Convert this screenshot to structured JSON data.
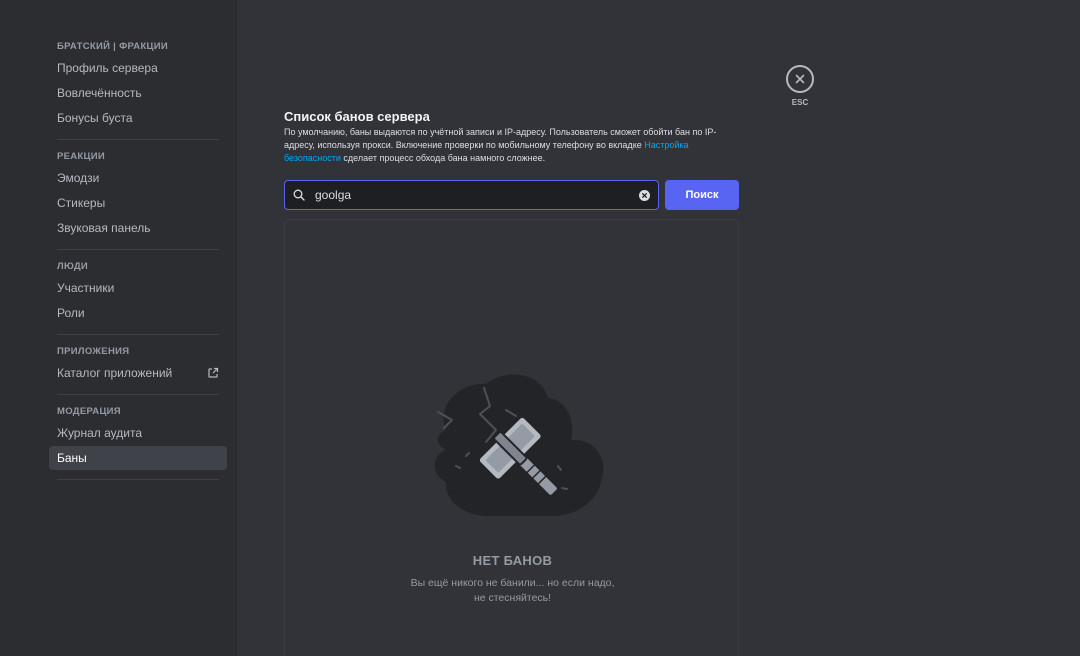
{
  "sidebar": {
    "sections": [
      {
        "header": "Братский | Фракции",
        "items": [
          {
            "label": "Профиль сервера"
          },
          {
            "label": "Вовлечённость"
          },
          {
            "label": "Бонусы буста"
          }
        ]
      },
      {
        "header": "Реакции",
        "items": [
          {
            "label": "Эмодзи"
          },
          {
            "label": "Стикеры"
          },
          {
            "label": "Звуковая панель"
          }
        ]
      },
      {
        "header": "Люди",
        "items": [
          {
            "label": "Участники"
          },
          {
            "label": "Роли"
          }
        ]
      },
      {
        "header": "Приложения",
        "items": [
          {
            "label": "Каталог приложений"
          }
        ]
      },
      {
        "header": "Модерация",
        "items": [
          {
            "label": "Журнал аудита"
          },
          {
            "label": "Баны",
            "selected": true
          }
        ]
      }
    ]
  },
  "main": {
    "title": "Список банов сервера",
    "description_part1": "По умолчанию, баны выдаются по учётной записи и IP-адресу. Пользователь сможет обойти бан по IP-адресу, используя прокси. Включение проверки по мобильному телефону во вкладке ",
    "description_link": "Настройка безопасности",
    "description_part2": " сделает процесс обхода бана намного сложнее.",
    "search": {
      "value": "goolga",
      "button_label": "Поиск"
    },
    "empty": {
      "title": "НЕТ БАНОВ",
      "text_line1": "Вы ещё никого не банили... но если надо,",
      "text_line2": "не стесняйтесь!"
    },
    "close": {
      "esc_label": "ESC"
    }
  },
  "colors": {
    "accent": "#5865f2",
    "link": "#00a8fc",
    "sidebar_bg": "#2b2d31",
    "content_bg": "#313338"
  }
}
